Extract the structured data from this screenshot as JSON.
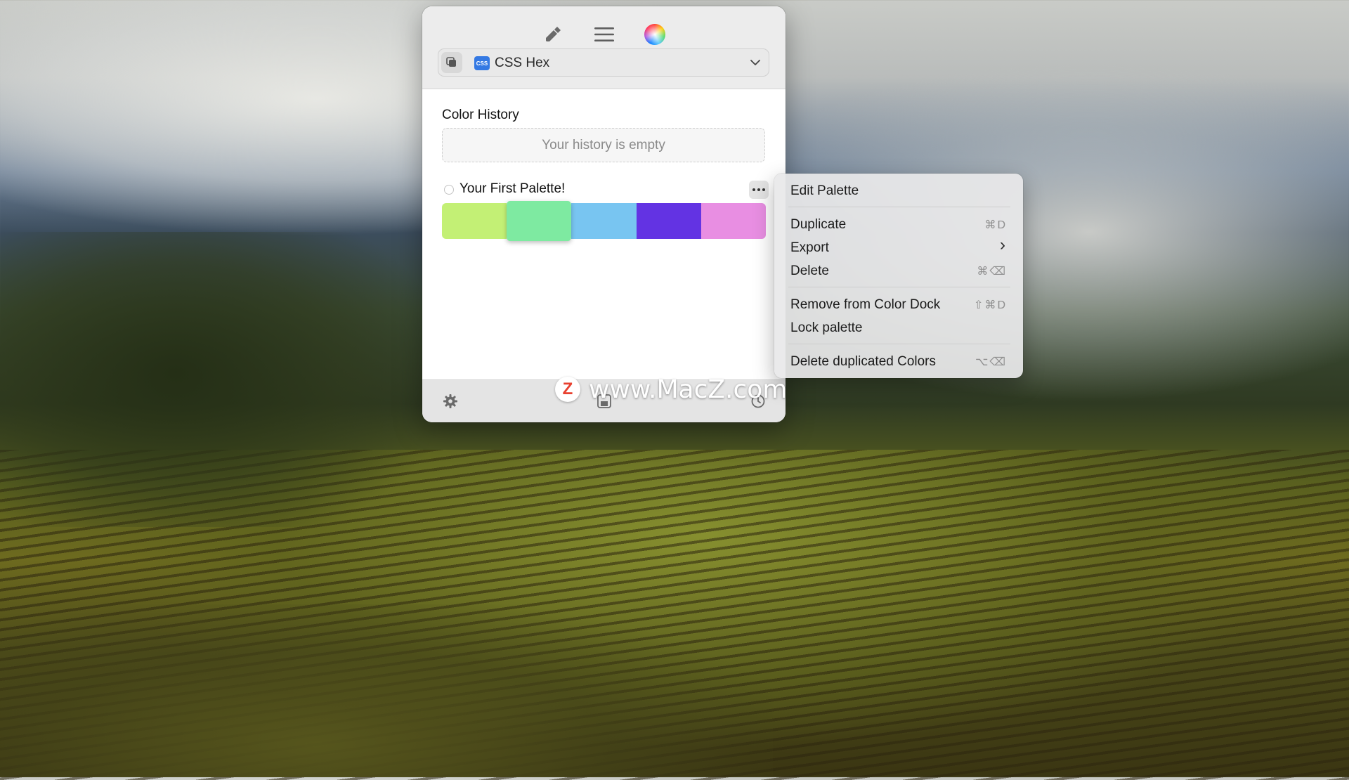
{
  "toolbar": {
    "icons": [
      "eyedropper-icon",
      "list-icon",
      "color-wheel-icon"
    ]
  },
  "format": {
    "badge": "CSS",
    "label": "CSS Hex"
  },
  "history": {
    "title": "Color History",
    "empty_text": "Your history is empty"
  },
  "palette": {
    "name": "Your First Palette!",
    "colors": [
      "#c3f075",
      "#7eeaa1",
      "#78c5f1",
      "#6333e3",
      "#e88ee2"
    ],
    "selected_index": 1
  },
  "bottom_bar": {
    "icons": [
      "gear-icon",
      "save-icon",
      "clock-icon"
    ]
  },
  "context_menu": {
    "edit_palette": "Edit Palette",
    "duplicate": "Duplicate",
    "duplicate_shortcut": "⌘D",
    "export": "Export",
    "export_arrow": "›",
    "delete": "Delete",
    "delete_shortcut": "⌘⌫",
    "remove_from_dock": "Remove from Color Dock",
    "remove_shortcut": "⇧⌘D",
    "lock_palette": "Lock palette",
    "delete_duplicates": "Delete duplicated Colors",
    "delete_duplicates_shortcut": "⌥⌫"
  },
  "watermark": {
    "logo": "Z",
    "text": "www.MacZ.com"
  }
}
